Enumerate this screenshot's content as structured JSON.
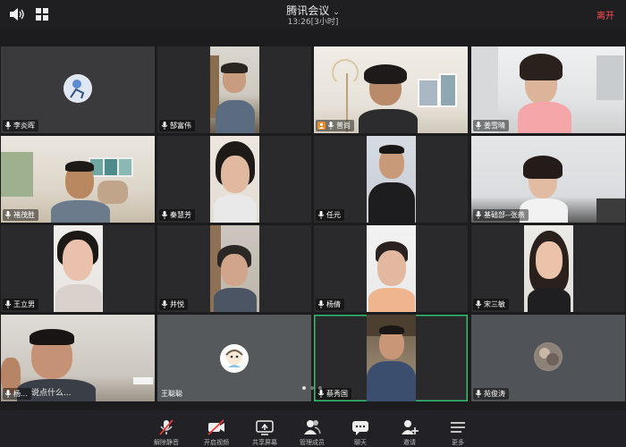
{
  "meeting": {
    "title": "腾讯会议",
    "duration": "13:26[3小时]",
    "leave_label": "离开"
  },
  "participants": [
    {
      "name": "李炎晖",
      "video": false,
      "avatar": "drawing-avatar"
    },
    {
      "name": "郜富伟",
      "video": true
    },
    {
      "name": "普尚",
      "video": true,
      "host": true
    },
    {
      "name": "姜雪晴",
      "video": true
    },
    {
      "name": "褚茂胜",
      "video": true
    },
    {
      "name": "秦慧芳",
      "video": true
    },
    {
      "name": "任元",
      "video": true
    },
    {
      "name": "基础部--张燕",
      "video": true
    },
    {
      "name": "王立男",
      "video": true
    },
    {
      "name": "井悦",
      "video": true
    },
    {
      "name": "杨倩",
      "video": true
    },
    {
      "name": "宋三敏",
      "video": true
    },
    {
      "name": "杨...",
      "video": true,
      "overlay_text": "说点什么..."
    },
    {
      "name": "王聪聪",
      "video": false,
      "avatar": "cartoon-avatar"
    },
    {
      "name": "蔡秀国",
      "video": true,
      "active_speaker": true
    },
    {
      "name": "苑俊涛",
      "video": false,
      "avatar": "photo-avatar"
    }
  ],
  "toolbar": [
    {
      "label": "解除静音",
      "icon": "mic-muted-icon"
    },
    {
      "label": "开启视频",
      "icon": "camera-off-icon"
    },
    {
      "label": "共享屏幕",
      "icon": "share-screen-icon"
    },
    {
      "label": "管理成员",
      "icon": "members-icon"
    },
    {
      "label": "聊天",
      "icon": "chat-icon"
    },
    {
      "label": "邀请",
      "icon": "invite-icon"
    },
    {
      "label": "更多",
      "icon": "more-icon"
    }
  ],
  "pager": {
    "pages": 3,
    "current": 1
  }
}
